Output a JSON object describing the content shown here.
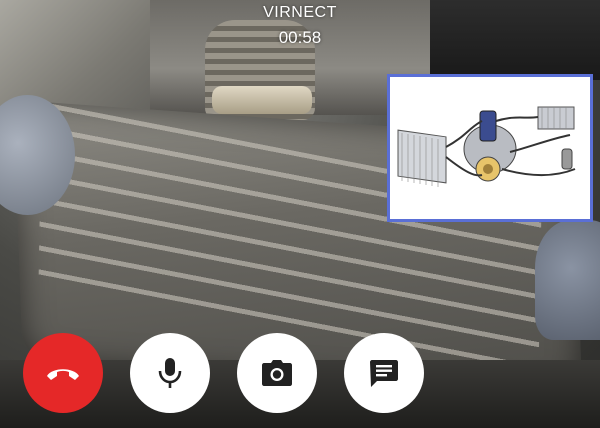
{
  "call": {
    "title": "VIRNECT",
    "timer": "00:58"
  },
  "colors": {
    "end_call": "#e52828",
    "control_bg": "#ffffff",
    "icon": "#222222",
    "doc_border": "#5a6fd6"
  },
  "controls": [
    {
      "name": "end-call-button",
      "icon": "phone-hangup-icon"
    },
    {
      "name": "microphone-button",
      "icon": "microphone-icon"
    },
    {
      "name": "camera-capture-button",
      "icon": "camera-icon"
    },
    {
      "name": "chat-button",
      "icon": "chat-icon"
    }
  ]
}
